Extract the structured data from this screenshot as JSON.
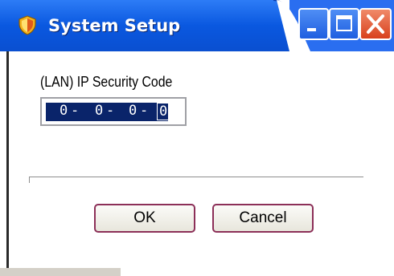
{
  "window": {
    "title": "System Setup",
    "icon": "shield-icon",
    "controls": {
      "minimize": "minimize-icon",
      "maximize": "maximize-icon",
      "close": "close-icon"
    }
  },
  "form": {
    "ip_label": "(LAN) IP Security Code",
    "ip_segments": [
      "0",
      "0",
      "0",
      "0"
    ]
  },
  "buttons": {
    "ok_label": "OK",
    "cancel_label": "Cancel"
  },
  "colors": {
    "title_blue": "#0a58e0",
    "selection": "#0a246a",
    "close_red": "#d8401c",
    "button_border": "#8c2f58"
  }
}
